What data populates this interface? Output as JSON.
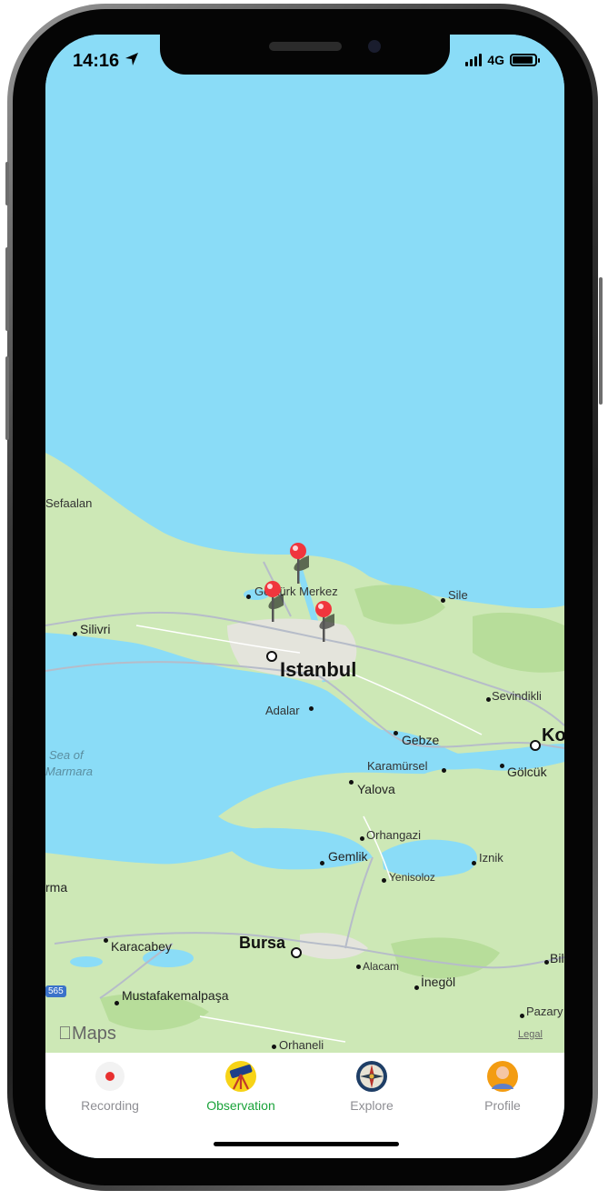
{
  "status_bar": {
    "time": "14:16",
    "network": "4G"
  },
  "map": {
    "attribution": "Maps",
    "legal": "Legal",
    "labels": {
      "sefaalan": "Sefaalan",
      "silivri": "Silivri",
      "gokturk": "Göktürk Merkez",
      "sile": "Sile",
      "istanbul": "Istanbul",
      "adalar": "Adalar",
      "sevindikli": "Sevindikli",
      "gebze": "Gebze",
      "kocaeli": "Ko",
      "sea": "Sea of",
      "marmara": "Marmara",
      "karamursel": "Karamürsel",
      "golcuk": "Gölcük",
      "yalova": "Yalova",
      "orhangazi": "Orhangazi",
      "gemlik": "Gemlik",
      "iznik": "Iznik",
      "yenisoloz": "Yenisoloz",
      "marma": "rma",
      "karacabey": "Karacabey",
      "bursa": "Bursa",
      "alacam": "Alacam",
      "inegol": "İnegöl",
      "mustafakemalpasa": "Mustafakemalpaşa",
      "pazary": "Pazary",
      "orhaneli": "Orhaneli",
      "bil": "Bil",
      "highway": "565"
    }
  },
  "tabs": [
    {
      "label": "Recording",
      "icon": "record-icon",
      "active": false
    },
    {
      "label": "Observation",
      "icon": "telescope-icon",
      "active": true
    },
    {
      "label": "Explore",
      "icon": "compass-icon",
      "active": false
    },
    {
      "label": "Profile",
      "icon": "profile-avatar-icon",
      "active": false
    }
  ],
  "colors": {
    "accent": "#1aa33a",
    "water": "#8adcf7",
    "land": "#cde8b6",
    "pin": "#f0353d"
  }
}
